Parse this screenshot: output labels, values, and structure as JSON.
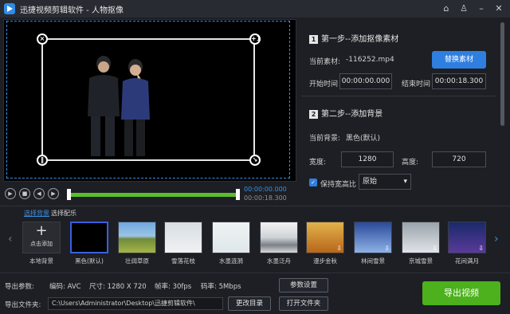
{
  "app": {
    "title": "迅捷视频剪辑软件 - 人物抠像",
    "window_controls": [
      "home-icon",
      "shirt-icon",
      "minimize-icon",
      "close-icon"
    ]
  },
  "preview": {
    "handle_tl": "×",
    "handle_tr": "+1",
    "handle_bl": "‖",
    "handle_br": "↘"
  },
  "player": {
    "current_time": "00:00:00.000",
    "total_time": "00:00:18.300",
    "progress": 0.02
  },
  "step1": {
    "number": "1",
    "title": "第一步--添加抠像素材",
    "material_label": "当前素材:",
    "material_value": "-116252.mp4",
    "replace_button": "替换素材",
    "start_label": "开始时间",
    "start_value": "00:00:00.000",
    "end_label": "结束时间",
    "end_value": "00:00:18.300"
  },
  "step2": {
    "number": "2",
    "title": "第二步--添加背景",
    "bg_label": "当前背景:",
    "bg_value": "黑色(默认)",
    "width_label": "宽度:",
    "width_value": "1280",
    "height_label": "高度:",
    "height_value": "720",
    "keep_ratio_label": "保持宽高比",
    "ratio_value": "原始"
  },
  "tabs": {
    "bg": "选择背景",
    "music": "选择配乐"
  },
  "backgrounds": [
    {
      "label": "本地背景",
      "inner": "点击添加"
    },
    {
      "label": "黑色(默认)"
    },
    {
      "label": "壮阔草原"
    },
    {
      "label": "雪落花枝"
    },
    {
      "label": "水墨涟漪"
    },
    {
      "label": "水墨泛舟"
    },
    {
      "label": "漫步金秋"
    },
    {
      "label": "林间雪景"
    },
    {
      "label": "京城雪景"
    },
    {
      "label": "花间满月"
    }
  ],
  "footer": {
    "params_label": "导出参数:",
    "encode": "编码:  AVC",
    "size": "尺寸:  1280 X 720",
    "fps": "帧率:  30fps",
    "bitrate": "码率:  5Mbps",
    "settings_button": "参数设置",
    "folder_label": "导出文件夹:",
    "folder_path": "C:\\Users\\Administrator\\Desktop\\迅捷剪辑软件\\",
    "change_dir_button": "更改目录",
    "open_folder_button": "打开文件夹",
    "export_button": "导出视频"
  },
  "colors": {
    "accent": "#2f7fe0",
    "export": "#4cb11c",
    "progress": "#5bbf2c"
  }
}
